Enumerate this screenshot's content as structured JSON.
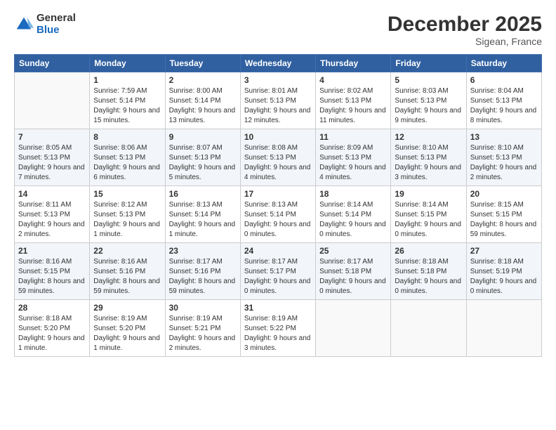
{
  "header": {
    "logo_general": "General",
    "logo_blue": "Blue",
    "title": "December 2025",
    "subtitle": "Sigean, France"
  },
  "calendar": {
    "days_of_week": [
      "Sunday",
      "Monday",
      "Tuesday",
      "Wednesday",
      "Thursday",
      "Friday",
      "Saturday"
    ],
    "weeks": [
      [
        {
          "num": "",
          "info": ""
        },
        {
          "num": "1",
          "info": "Sunrise: 7:59 AM\nSunset: 5:14 PM\nDaylight: 9 hours\nand 15 minutes."
        },
        {
          "num": "2",
          "info": "Sunrise: 8:00 AM\nSunset: 5:14 PM\nDaylight: 9 hours\nand 13 minutes."
        },
        {
          "num": "3",
          "info": "Sunrise: 8:01 AM\nSunset: 5:13 PM\nDaylight: 9 hours\nand 12 minutes."
        },
        {
          "num": "4",
          "info": "Sunrise: 8:02 AM\nSunset: 5:13 PM\nDaylight: 9 hours\nand 11 minutes."
        },
        {
          "num": "5",
          "info": "Sunrise: 8:03 AM\nSunset: 5:13 PM\nDaylight: 9 hours\nand 9 minutes."
        },
        {
          "num": "6",
          "info": "Sunrise: 8:04 AM\nSunset: 5:13 PM\nDaylight: 9 hours\nand 8 minutes."
        }
      ],
      [
        {
          "num": "7",
          "info": "Sunrise: 8:05 AM\nSunset: 5:13 PM\nDaylight: 9 hours\nand 7 minutes."
        },
        {
          "num": "8",
          "info": "Sunrise: 8:06 AM\nSunset: 5:13 PM\nDaylight: 9 hours\nand 6 minutes."
        },
        {
          "num": "9",
          "info": "Sunrise: 8:07 AM\nSunset: 5:13 PM\nDaylight: 9 hours\nand 5 minutes."
        },
        {
          "num": "10",
          "info": "Sunrise: 8:08 AM\nSunset: 5:13 PM\nDaylight: 9 hours\nand 4 minutes."
        },
        {
          "num": "11",
          "info": "Sunrise: 8:09 AM\nSunset: 5:13 PM\nDaylight: 9 hours\nand 4 minutes."
        },
        {
          "num": "12",
          "info": "Sunrise: 8:10 AM\nSunset: 5:13 PM\nDaylight: 9 hours\nand 3 minutes."
        },
        {
          "num": "13",
          "info": "Sunrise: 8:10 AM\nSunset: 5:13 PM\nDaylight: 9 hours\nand 2 minutes."
        }
      ],
      [
        {
          "num": "14",
          "info": "Sunrise: 8:11 AM\nSunset: 5:13 PM\nDaylight: 9 hours\nand 2 minutes."
        },
        {
          "num": "15",
          "info": "Sunrise: 8:12 AM\nSunset: 5:13 PM\nDaylight: 9 hours\nand 1 minute."
        },
        {
          "num": "16",
          "info": "Sunrise: 8:13 AM\nSunset: 5:14 PM\nDaylight: 9 hours\nand 1 minute."
        },
        {
          "num": "17",
          "info": "Sunrise: 8:13 AM\nSunset: 5:14 PM\nDaylight: 9 hours\nand 0 minutes."
        },
        {
          "num": "18",
          "info": "Sunrise: 8:14 AM\nSunset: 5:14 PM\nDaylight: 9 hours\nand 0 minutes."
        },
        {
          "num": "19",
          "info": "Sunrise: 8:14 AM\nSunset: 5:15 PM\nDaylight: 9 hours\nand 0 minutes."
        },
        {
          "num": "20",
          "info": "Sunrise: 8:15 AM\nSunset: 5:15 PM\nDaylight: 8 hours\nand 59 minutes."
        }
      ],
      [
        {
          "num": "21",
          "info": "Sunrise: 8:16 AM\nSunset: 5:15 PM\nDaylight: 8 hours\nand 59 minutes."
        },
        {
          "num": "22",
          "info": "Sunrise: 8:16 AM\nSunset: 5:16 PM\nDaylight: 8 hours\nand 59 minutes."
        },
        {
          "num": "23",
          "info": "Sunrise: 8:17 AM\nSunset: 5:16 PM\nDaylight: 8 hours\nand 59 minutes."
        },
        {
          "num": "24",
          "info": "Sunrise: 8:17 AM\nSunset: 5:17 PM\nDaylight: 9 hours\nand 0 minutes."
        },
        {
          "num": "25",
          "info": "Sunrise: 8:17 AM\nSunset: 5:18 PM\nDaylight: 9 hours\nand 0 minutes."
        },
        {
          "num": "26",
          "info": "Sunrise: 8:18 AM\nSunset: 5:18 PM\nDaylight: 9 hours\nand 0 minutes."
        },
        {
          "num": "27",
          "info": "Sunrise: 8:18 AM\nSunset: 5:19 PM\nDaylight: 9 hours\nand 0 minutes."
        }
      ],
      [
        {
          "num": "28",
          "info": "Sunrise: 8:18 AM\nSunset: 5:20 PM\nDaylight: 9 hours\nand 1 minute."
        },
        {
          "num": "29",
          "info": "Sunrise: 8:19 AM\nSunset: 5:20 PM\nDaylight: 9 hours\nand 1 minute."
        },
        {
          "num": "30",
          "info": "Sunrise: 8:19 AM\nSunset: 5:21 PM\nDaylight: 9 hours\nand 2 minutes."
        },
        {
          "num": "31",
          "info": "Sunrise: 8:19 AM\nSunset: 5:22 PM\nDaylight: 9 hours\nand 3 minutes."
        },
        {
          "num": "",
          "info": ""
        },
        {
          "num": "",
          "info": ""
        },
        {
          "num": "",
          "info": ""
        }
      ]
    ]
  }
}
